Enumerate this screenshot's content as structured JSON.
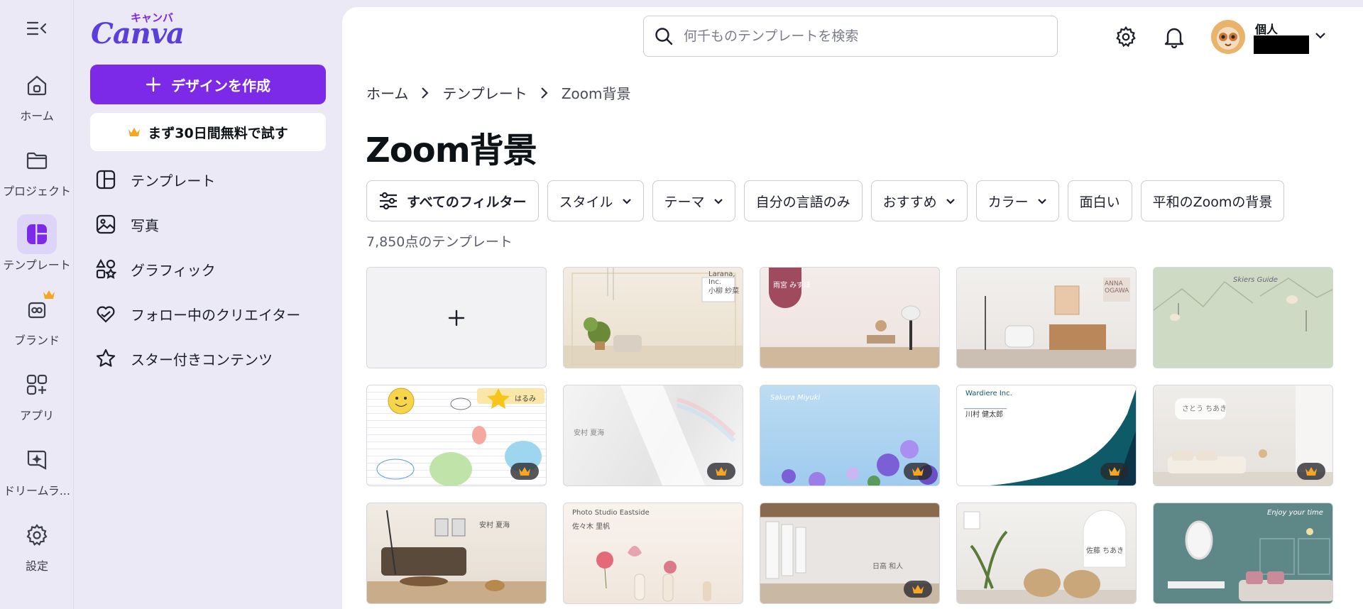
{
  "rail": {
    "items": [
      {
        "label": "ホーム",
        "icon": "home-icon"
      },
      {
        "label": "プロジェクト",
        "icon": "folder-icon"
      },
      {
        "label": "テンプレート",
        "icon": "template-icon"
      },
      {
        "label": "ブランド",
        "icon": "brand-icon"
      },
      {
        "label": "アプリ",
        "icon": "apps-icon"
      },
      {
        "label": "ドリームラ...",
        "icon": "dream-lab-icon"
      },
      {
        "label": "設定",
        "icon": "gear-icon"
      }
    ]
  },
  "panel": {
    "logo_text": "Canva",
    "logo_kana": "キャンバ",
    "create_label": "デザインを作成",
    "trial_label": "まず30日間無料で試す",
    "nav": [
      {
        "label": "テンプレート",
        "icon": "template-outline-icon"
      },
      {
        "label": "写真",
        "icon": "photo-icon"
      },
      {
        "label": "グラフィック",
        "icon": "graphics-icon"
      },
      {
        "label": "フォロー中のクリエイター",
        "icon": "heart-icon"
      },
      {
        "label": "スター付きコンテンツ",
        "icon": "star-icon"
      }
    ]
  },
  "header": {
    "search_placeholder": "何千ものテンプレートを検索",
    "account_name": "個人"
  },
  "breadcrumb": [
    "ホーム",
    "テンプレート",
    "Zoom背景"
  ],
  "page_title": "Zoom背景",
  "filters": [
    {
      "label": "すべてのフィルター",
      "icon": "filter-icon",
      "dropdown": false
    },
    {
      "label": "スタイル",
      "dropdown": true
    },
    {
      "label": "テーマ",
      "dropdown": true
    },
    {
      "label": "自分の言語のみ",
      "dropdown": false
    },
    {
      "label": "おすすめ",
      "dropdown": true
    },
    {
      "label": "カラー",
      "dropdown": true
    },
    {
      "label": "面白い",
      "dropdown": false
    },
    {
      "label": "平和のZoomの背景",
      "dropdown": false
    }
  ],
  "template_count": "7,850点のテンプレート",
  "colors": {
    "accent": "#7d2ae8",
    "rail_bg": "#ece9f7",
    "active_bg": "#ddd5f8",
    "crown": "#f5a623"
  },
  "tiles": [
    {
      "kind": "blank"
    },
    {
      "kind": "room-beige",
      "label": "Larana, Inc.",
      "label2": "小柳 紗菜",
      "premium": false
    },
    {
      "kind": "room-pink",
      "label": "雨宮 みずほ",
      "premium": false
    },
    {
      "kind": "room-living",
      "label": "ANNA OGAWA",
      "premium": false
    },
    {
      "kind": "mint-mountain",
      "label": "Skiers Guide",
      "premium": false
    },
    {
      "kind": "kids-drawing",
      "label": "はるみ",
      "premium": true
    },
    {
      "kind": "white-light",
      "label": "安村 夏海",
      "premium": true
    },
    {
      "kind": "blue-flowers",
      "label": "Sakura Miyuki",
      "premium": true
    },
    {
      "kind": "corporate-wave",
      "label": "Wardiere Inc.",
      "label2": "川村 健太郎",
      "premium": true
    },
    {
      "kind": "white-sofa",
      "label": "さとう ちあき",
      "premium": true
    },
    {
      "kind": "brown-living",
      "label": "安村 夏海",
      "premium": false
    },
    {
      "kind": "pastel-vases",
      "label": "Photo Studio Eastside",
      "label2": "佐々木 里帆",
      "premium": false
    },
    {
      "kind": "empty-room",
      "label": "日高 和人",
      "premium": true
    },
    {
      "kind": "rattan-chairs",
      "label": "佐藤 ちあき",
      "premium": false
    },
    {
      "kind": "teal-wall",
      "label": "Enjoy your time",
      "premium": false
    }
  ]
}
